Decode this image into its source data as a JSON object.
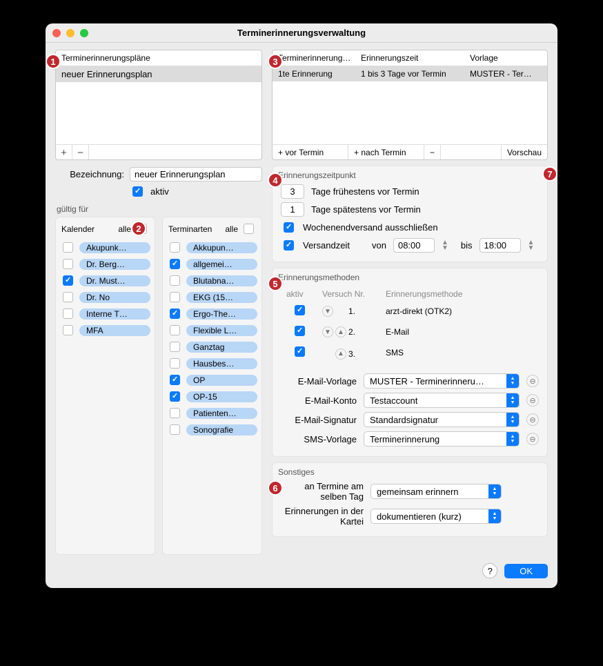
{
  "window": {
    "title": "Terminerinnerungsverwaltung"
  },
  "plans": {
    "header": "Terminerinnerungspläne",
    "items": [
      "neuer Erinnerungsplan"
    ],
    "add": "+",
    "remove": "−"
  },
  "form": {
    "bez_label": "Bezeichnung:",
    "bez_value": "neuer Erinnerungsplan",
    "aktiv_label": "aktiv",
    "gueltig_label": "gültig für"
  },
  "kalender": {
    "title": "Kalender",
    "alle": "alle",
    "items": [
      {
        "label": "Akupunk…",
        "checked": false
      },
      {
        "label": "Dr. Berg…",
        "checked": false
      },
      {
        "label": "Dr. Must…",
        "checked": true
      },
      {
        "label": "Dr. No",
        "checked": false
      },
      {
        "label": "Interne T…",
        "checked": false
      },
      {
        "label": "MFA",
        "checked": false
      }
    ]
  },
  "terminarten": {
    "title": "Terminarten",
    "alle": "alle",
    "items": [
      {
        "label": "Akkupun…",
        "checked": false
      },
      {
        "label": "allgemei…",
        "checked": true
      },
      {
        "label": "Blutabna…",
        "checked": false
      },
      {
        "label": "EKG (15…",
        "checked": false
      },
      {
        "label": "Ergo-The…",
        "checked": true
      },
      {
        "label": "Flexible L…",
        "checked": false
      },
      {
        "label": "Ganztag",
        "checked": false
      },
      {
        "label": "Hausbes…",
        "checked": false
      },
      {
        "label": "OP",
        "checked": true
      },
      {
        "label": "OP-15",
        "checked": true
      },
      {
        "label": "Patienten…",
        "checked": false
      },
      {
        "label": "Sonografie",
        "checked": false
      }
    ]
  },
  "reminders": {
    "cols": {
      "c1": "Terminerinnerung…",
      "c2": "Erinnerungszeit",
      "c3": "Vorlage"
    },
    "row": {
      "c1": "1te Erinnerung",
      "c2": "1 bis 3 Tage vor Termin",
      "c3": "MUSTER - Ter…"
    },
    "foot": {
      "vor": "+ vor Termin",
      "nach": "+ nach Termin",
      "minus": "−",
      "preview": "Vorschau"
    }
  },
  "zeitpunkt": {
    "title": "Erinnerungszeitpunkt",
    "fruh": "3",
    "fruh_lbl": "Tage frühestens vor Termin",
    "spat": "1",
    "spat_lbl": "Tage spätestens vor Termin",
    "we": "Wochenendversand ausschließen",
    "vz": "Versandzeit",
    "von": "von",
    "von_v": "08:00",
    "bis": "bis",
    "bis_v": "18:00"
  },
  "methoden": {
    "title": "Erinnerungsmethoden",
    "cols": {
      "a": "aktiv",
      "b": "Versuch Nr.",
      "c": "Erinnerungsmethode"
    },
    "rows": [
      {
        "n": "1.",
        "m": "arzt-direkt (OTK2)"
      },
      {
        "n": "2.",
        "m": "E-Mail"
      },
      {
        "n": "3.",
        "m": "SMS"
      }
    ],
    "sel": [
      {
        "l": "E-Mail-Vorlage",
        "v": "MUSTER - Terminerinneru…"
      },
      {
        "l": "E-Mail-Konto",
        "v": "Testaccount"
      },
      {
        "l": "E-Mail-Signatur",
        "v": "Standardsignatur"
      },
      {
        "l": "SMS-Vorlage",
        "v": "Terminerinnerung"
      }
    ]
  },
  "sonstiges": {
    "title": "Sonstiges",
    "r1l": "an Termine am selben Tag",
    "r1v": "gemeinsam erinnern",
    "r2l": "Erinnerungen in der Kartei",
    "r2v": "dokumentieren (kurz)"
  },
  "footer": {
    "ok": "OK",
    "help": "?"
  },
  "badges": {
    "1": "1",
    "2": "2",
    "3": "3",
    "4": "4",
    "5": "5",
    "6": "6",
    "7": "7"
  }
}
